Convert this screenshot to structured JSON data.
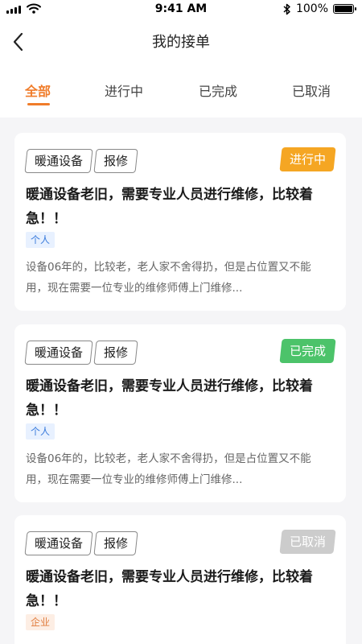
{
  "status_bar": {
    "time": "9:41 AM",
    "battery_text": "100%",
    "battery_level": 1.0,
    "icons": [
      "cellular-signal-icon",
      "wifi-icon",
      "bluetooth-icon",
      "battery-icon"
    ]
  },
  "header": {
    "title": "我的接单",
    "back_icon": "chevron-left-icon"
  },
  "tabs": [
    {
      "label": "全部",
      "active": true
    },
    {
      "label": "进行中",
      "active": false
    },
    {
      "label": "已完成",
      "active": false
    },
    {
      "label": "已取消",
      "active": false
    }
  ],
  "colors": {
    "accent": "#f07c2a",
    "status_in_progress": "#f5a623",
    "status_completed": "#4cc36a",
    "status_cancelled": "#cccccc"
  },
  "orders": [
    {
      "tags": [
        "暖通设备",
        "报修"
      ],
      "status": "进行中",
      "title": "暖通设备老旧，需要专业人员进行维修，比较着急！！",
      "customer_type": "个人",
      "description": "设备06年的，比较老，老人家不舍得扔，但是占位置又不能用，现在需要一位专业的维修师傅上门维修..."
    },
    {
      "tags": [
        "暖通设备",
        "报修"
      ],
      "status": "已完成",
      "title": "暖通设备老旧，需要专业人员进行维修，比较着急！！",
      "customer_type": "个人",
      "description": "设备06年的，比较老，老人家不舍得扔，但是占位置又不能用，现在需要一位专业的维修师傅上门维修..."
    },
    {
      "tags": [
        "暖通设备",
        "报修"
      ],
      "status": "已取消",
      "title": "暖通设备老旧，需要专业人员进行维修，比较着急！！",
      "customer_type": "企业"
    }
  ]
}
